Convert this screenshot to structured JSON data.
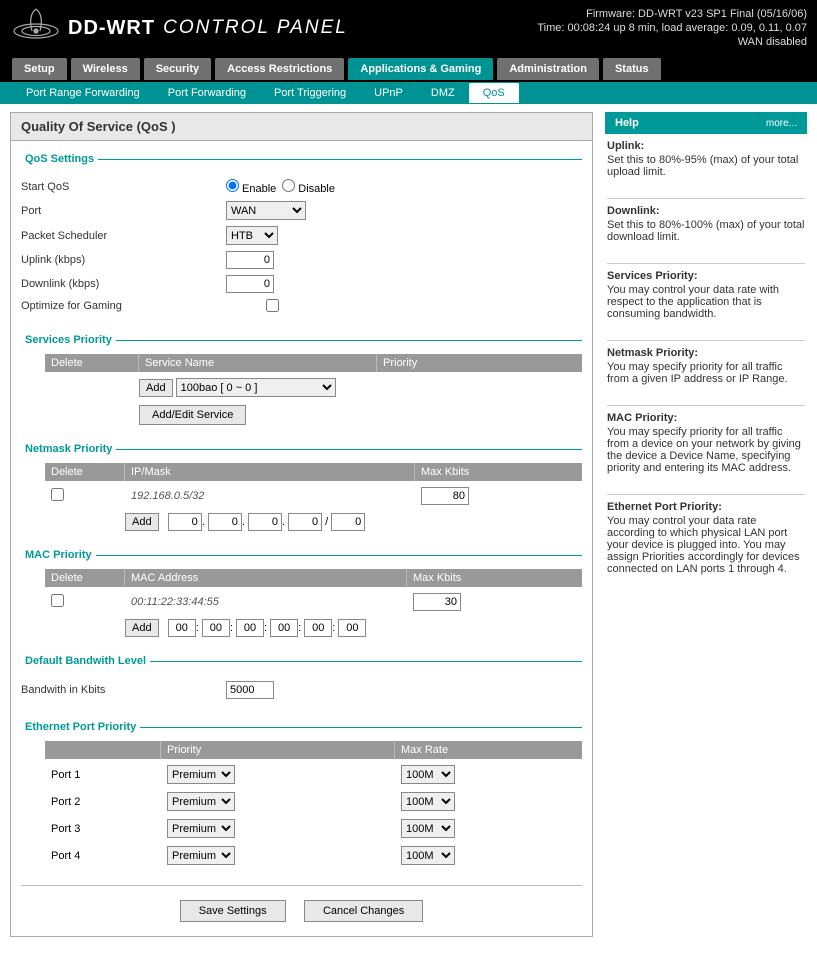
{
  "logo": {
    "brand": "DD-WRT",
    "subtitle": "CONTROL PANEL"
  },
  "status": {
    "firmware": "Firmware: DD-WRT v23 SP1 Final (05/16/06)",
    "time": "Time: 00:08:24 up 8 min, load average: 0.09, 0.11, 0.07",
    "wan": "WAN disabled"
  },
  "mainTabs": [
    "Setup",
    "Wireless",
    "Security",
    "Access Restrictions",
    "Applications & Gaming",
    "Administration",
    "Status"
  ],
  "mainTabActive": 4,
  "subTabs": [
    "Port Range Forwarding",
    "Port Forwarding",
    "Port Triggering",
    "UPnP",
    "DMZ",
    "QoS"
  ],
  "subTabActive": 5,
  "pageTitle": "Quality Of Service (QoS )",
  "qosSettings": {
    "legend": "QoS Settings",
    "startQosLabel": "Start QoS",
    "enableLabel": "Enable",
    "disableLabel": "Disable",
    "startQos": "enable",
    "portLabel": "Port",
    "portValue": "WAN",
    "schedulerLabel": "Packet Scheduler",
    "schedulerValue": "HTB",
    "uplinkLabel": "Uplink (kbps)",
    "uplinkValue": "0",
    "downlinkLabel": "Downlink (kbps)",
    "downlinkValue": "0",
    "optimizeLabel": "Optimize for Gaming",
    "optimizeChecked": false
  },
  "servicesPriority": {
    "legend": "Services Priority",
    "cols": {
      "delete": "Delete",
      "service": "Service Name",
      "priority": "Priority"
    },
    "addBtn": "Add",
    "addEditBtn": "Add/Edit Service",
    "serviceValue": "100bao [ 0 ~ 0 ]"
  },
  "netmaskPriority": {
    "legend": "Netmask Priority",
    "cols": {
      "delete": "Delete",
      "ipmask": "IP/Mask",
      "maxkbits": "Max Kbits"
    },
    "row": {
      "ip": "192.168.0.5/32",
      "max": "80"
    },
    "addBtn": "Add",
    "ipFields": [
      "0",
      "0",
      "0",
      "0"
    ],
    "maskField": "0"
  },
  "macPriority": {
    "legend": "MAC Priority",
    "cols": {
      "delete": "Delete",
      "mac": "MAC Address",
      "maxkbits": "Max Kbits"
    },
    "row": {
      "mac": "00:11:22:33:44:55",
      "max": "30"
    },
    "addBtn": "Add",
    "macFields": [
      "00",
      "00",
      "00",
      "00",
      "00",
      "00"
    ]
  },
  "defaultBw": {
    "legend": "Default Bandwith Level",
    "label": "Bandwith in Kbits",
    "value": "5000"
  },
  "ethPriority": {
    "legend": "Ethernet Port Priority",
    "cols": {
      "priority": "Priority",
      "maxrate": "Max Rate"
    },
    "ports": [
      {
        "label": "Port 1",
        "prio": "Premium",
        "rate": "100M"
      },
      {
        "label": "Port 2",
        "prio": "Premium",
        "rate": "100M"
      },
      {
        "label": "Port 3",
        "prio": "Premium",
        "rate": "100M"
      },
      {
        "label": "Port 4",
        "prio": "Premium",
        "rate": "100M"
      }
    ]
  },
  "buttons": {
    "save": "Save Settings",
    "cancel": "Cancel Changes"
  },
  "help": {
    "title": "Help",
    "more": "more...",
    "items": [
      {
        "t": "Uplink:",
        "d": "Set this to 80%-95% (max) of your total upload limit."
      },
      {
        "t": "Downlink:",
        "d": "Set this to 80%-100% (max) of your total download limit."
      },
      {
        "t": "Services Priority:",
        "d": "You may control your data rate with respect to the application that is consuming bandwidth."
      },
      {
        "t": "Netmask Priority:",
        "d": "You may specify priority for all traffic from a given IP address or IP Range."
      },
      {
        "t": "MAC Priority:",
        "d": "You may specify priority for all traffic from a device on your network by giving the device a Device Name, specifying priority and entering its MAC address."
      },
      {
        "t": "Ethernet Port Priority:",
        "d": "You may control your data rate according to which physical LAN port your device is plugged into. You may assign Priorities accordingly for devices connected on LAN ports 1 through 4."
      }
    ]
  }
}
